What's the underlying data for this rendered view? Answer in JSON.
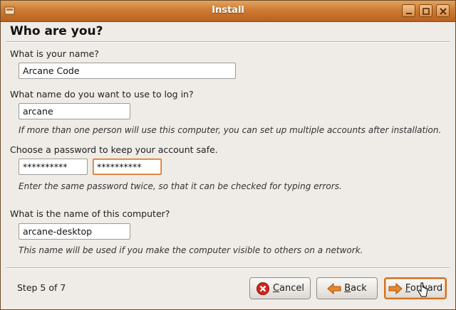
{
  "window": {
    "title": "Install"
  },
  "page": {
    "title": "Who are you?"
  },
  "name_section": {
    "label": "What is your name?",
    "value": "Arcane Code"
  },
  "login_section": {
    "label": "What name do you want to use to log in?",
    "value": "arcane",
    "hint": "If more than one person will use this computer, you can set up multiple accounts after installation."
  },
  "password_section": {
    "label": "Choose a password to keep your account safe.",
    "password_value": "**********",
    "confirm_value": "**********",
    "hint": "Enter the same password twice, so that it can be checked for typing errors."
  },
  "computer_section": {
    "label": "What is the name of this computer?",
    "value": "arcane-desktop",
    "hint": "This name will be used if you make the computer visible to others on a network."
  },
  "footer": {
    "step": "Step 5 of 7",
    "cancel_label": "Cancel",
    "back_label": "Back",
    "forward_label": "Forward"
  },
  "icons": {
    "cancel": "cancel-icon",
    "back": "back-arrow-icon",
    "forward": "forward-arrow-icon",
    "minimize": "minimize-icon",
    "maximize": "maximize-icon",
    "close": "close-icon"
  },
  "colors": {
    "titlebar": "#cf7b32",
    "focus_border": "#d9732b",
    "cancel_icon": "#d4241c",
    "arrow_icon": "#e8862b"
  }
}
